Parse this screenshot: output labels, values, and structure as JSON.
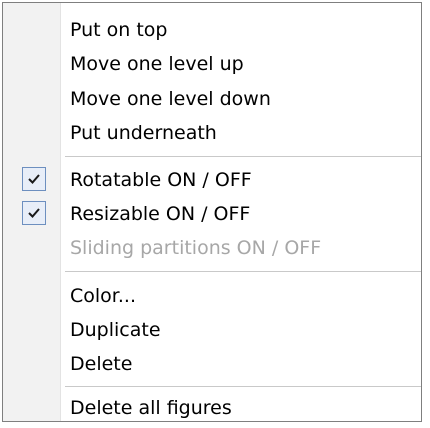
{
  "menu": {
    "items": [
      {
        "label": "Put on top"
      },
      {
        "label": "Move one level up"
      },
      {
        "label": "Move one level down"
      },
      {
        "label": "Put underneath"
      },
      {
        "label": "Rotatable ON / OFF",
        "checked": true
      },
      {
        "label": "Resizable ON / OFF",
        "checked": true
      },
      {
        "label": "Sliding partitions ON / OFF",
        "disabled": true
      },
      {
        "label": "Color..."
      },
      {
        "label": "Duplicate"
      },
      {
        "label": "Delete"
      },
      {
        "label": "Delete all figures"
      }
    ],
    "check_icon": "checkmark-icon",
    "colors": {
      "disabled_text": "#a7a7a7",
      "check_border": "#6d8fbf",
      "check_fill": "#e8eef8"
    }
  }
}
